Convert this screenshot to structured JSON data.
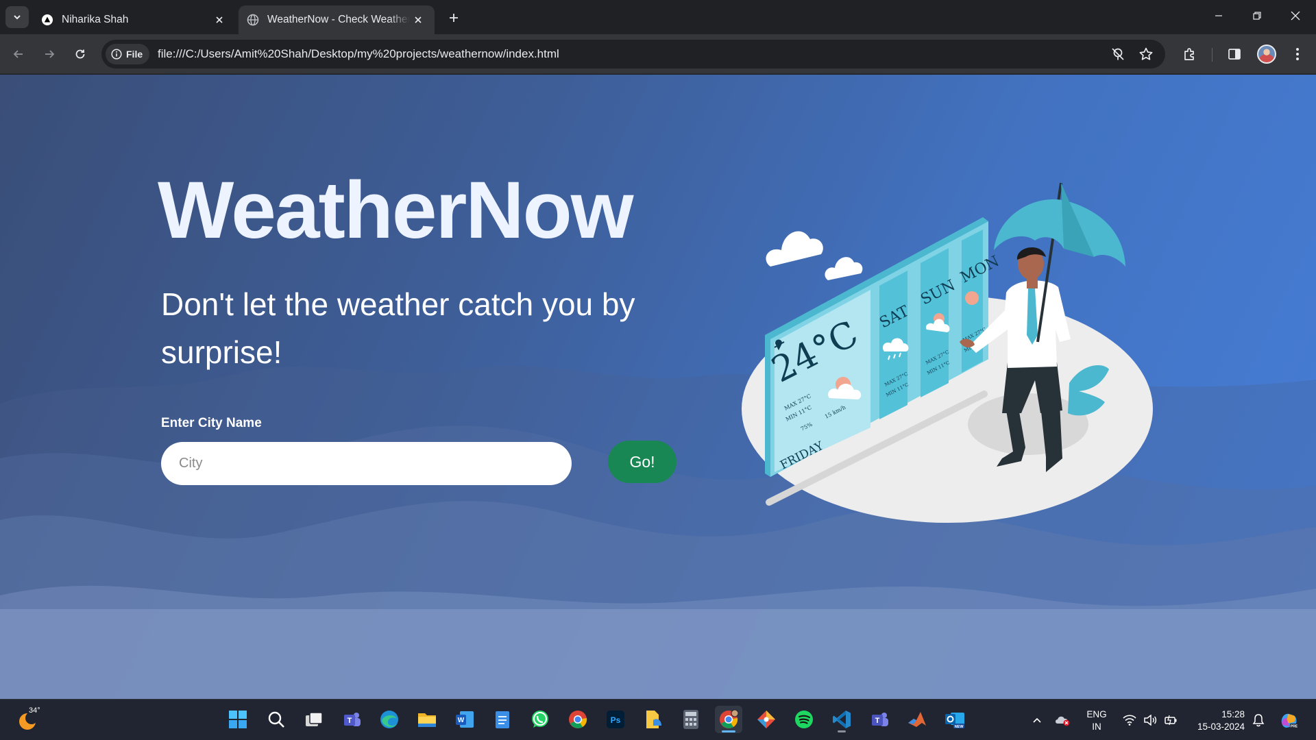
{
  "browser": {
    "tabs": [
      {
        "title": "Niharika Shah",
        "active": false
      },
      {
        "title": "WeatherNow - Check Weather of Any City",
        "active": true
      }
    ],
    "security_chip": "File",
    "url": "file:///C:/Users/Amit%20Shah/Desktop/my%20projects/weathernow/index.html"
  },
  "page": {
    "title": "WeatherNow",
    "tagline": "Don't let the weather catch you by surprise!",
    "city_label": "Enter City Name",
    "city_placeholder": "City",
    "city_value": "",
    "go_label": "Go!",
    "accent_color": "#198754",
    "illustration": {
      "temperature": "24°C",
      "day": "FRIDAY",
      "details": [
        "MAX 27°C",
        "MIN 11°C",
        "75%",
        "15 km/h"
      ],
      "forecast": [
        {
          "day": "SAT",
          "max": "MAX 27°C",
          "min": "MIN 11°C"
        },
        {
          "day": "SUN",
          "max": "MAX 27°C",
          "min": "MIN 11°C"
        },
        {
          "day": "MON",
          "max": "MAX 27°C",
          "min": "MIN 11°C"
        }
      ]
    }
  },
  "taskbar": {
    "weather_temp": "34°",
    "apps": [
      "start",
      "search",
      "task-view",
      "teams",
      "edge",
      "file-explorer",
      "word",
      "notepad",
      "whatsapp",
      "chrome-alt",
      "photoshop",
      "sticky-files",
      "calculator",
      "chrome",
      "git-tool",
      "spotify",
      "vscode",
      "teams-work",
      "matlab",
      "outlook-new"
    ],
    "language": "ENG",
    "region": "IN",
    "time": "15:28",
    "date": "15-03-2024"
  }
}
